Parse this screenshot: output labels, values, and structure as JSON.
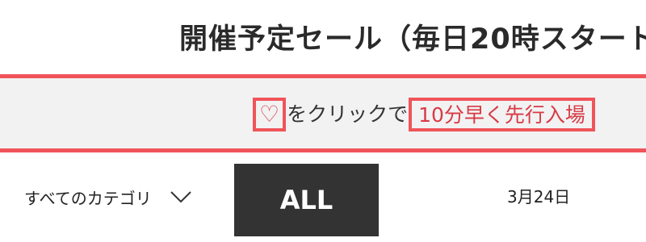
{
  "header": {
    "title": "開催予定セール（毎日20時スタート"
  },
  "banner": {
    "heart_symbol": "♡",
    "middle_text": "をクリックで",
    "highlight_text": "10分早く先行入場",
    "accent_color": "#f0545a",
    "text_accent_color": "#d83a46",
    "background_color": "#f2f2f2"
  },
  "filters": {
    "category_label": "すべてのカテゴリ",
    "category_icon": "chevron-down-icon",
    "all_label": "ALL",
    "date_label": "3月24日"
  }
}
